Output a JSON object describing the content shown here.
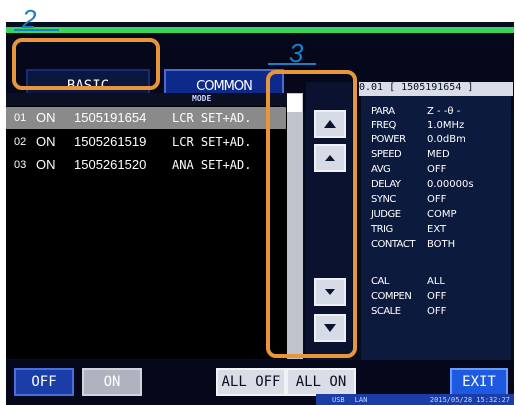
{
  "step_labels": {
    "tabs": "2",
    "scroll": "3"
  },
  "tabs": {
    "basic": "BASIC",
    "common": "COMMON"
  },
  "list": {
    "mode_header": "MODE",
    "rows": [
      {
        "no": "01",
        "state": "ON",
        "id": "1505191654",
        "mode": "LCR SET+AD."
      },
      {
        "no": "02",
        "state": "ON",
        "id": "1505261519",
        "mode": "LCR SET+AD."
      },
      {
        "no": "03",
        "state": "ON",
        "id": "1505261520",
        "mode": "ANA SET+AD."
      }
    ]
  },
  "params": {
    "header": "0.01 [ 1505191654 ]",
    "rows": [
      {
        "k": "PARA",
        "v": "Z -   -θ -"
      },
      {
        "k": "FREQ",
        "v": "  1.0MHz"
      },
      {
        "k": "POWER",
        "v": "0.0dBm"
      },
      {
        "k": "SPEED",
        "v": "MED"
      },
      {
        "k": "AVG",
        "v": "OFF"
      },
      {
        "k": "DELAY",
        "v": "0.00000s"
      },
      {
        "k": "SYNC",
        "v": "OFF"
      },
      {
        "k": "JUDGE",
        "v": "COMP"
      },
      {
        "k": "TRIG",
        "v": "EXT"
      },
      {
        "k": "CONTACT",
        "v": "BOTH"
      },
      {
        "k": "CAL",
        "v": "ALL"
      },
      {
        "k": "COMPEN",
        "v": "OFF"
      },
      {
        "k": "SCALE",
        "v": "OFF"
      }
    ]
  },
  "bottom": {
    "off": "OFF",
    "on": "ON",
    "all_off": "ALL OFF",
    "all_on": "ALL ON",
    "exit": "EXIT"
  },
  "status": {
    "usb": "USB",
    "lan": "LAN",
    "time": "2015/05/28 15:32:27"
  },
  "colors": {
    "callout": "#e8963c",
    "step_number": "#1a7fc6",
    "selected_tab": "#0c1740",
    "accent_blue": "#1e5ae0"
  }
}
